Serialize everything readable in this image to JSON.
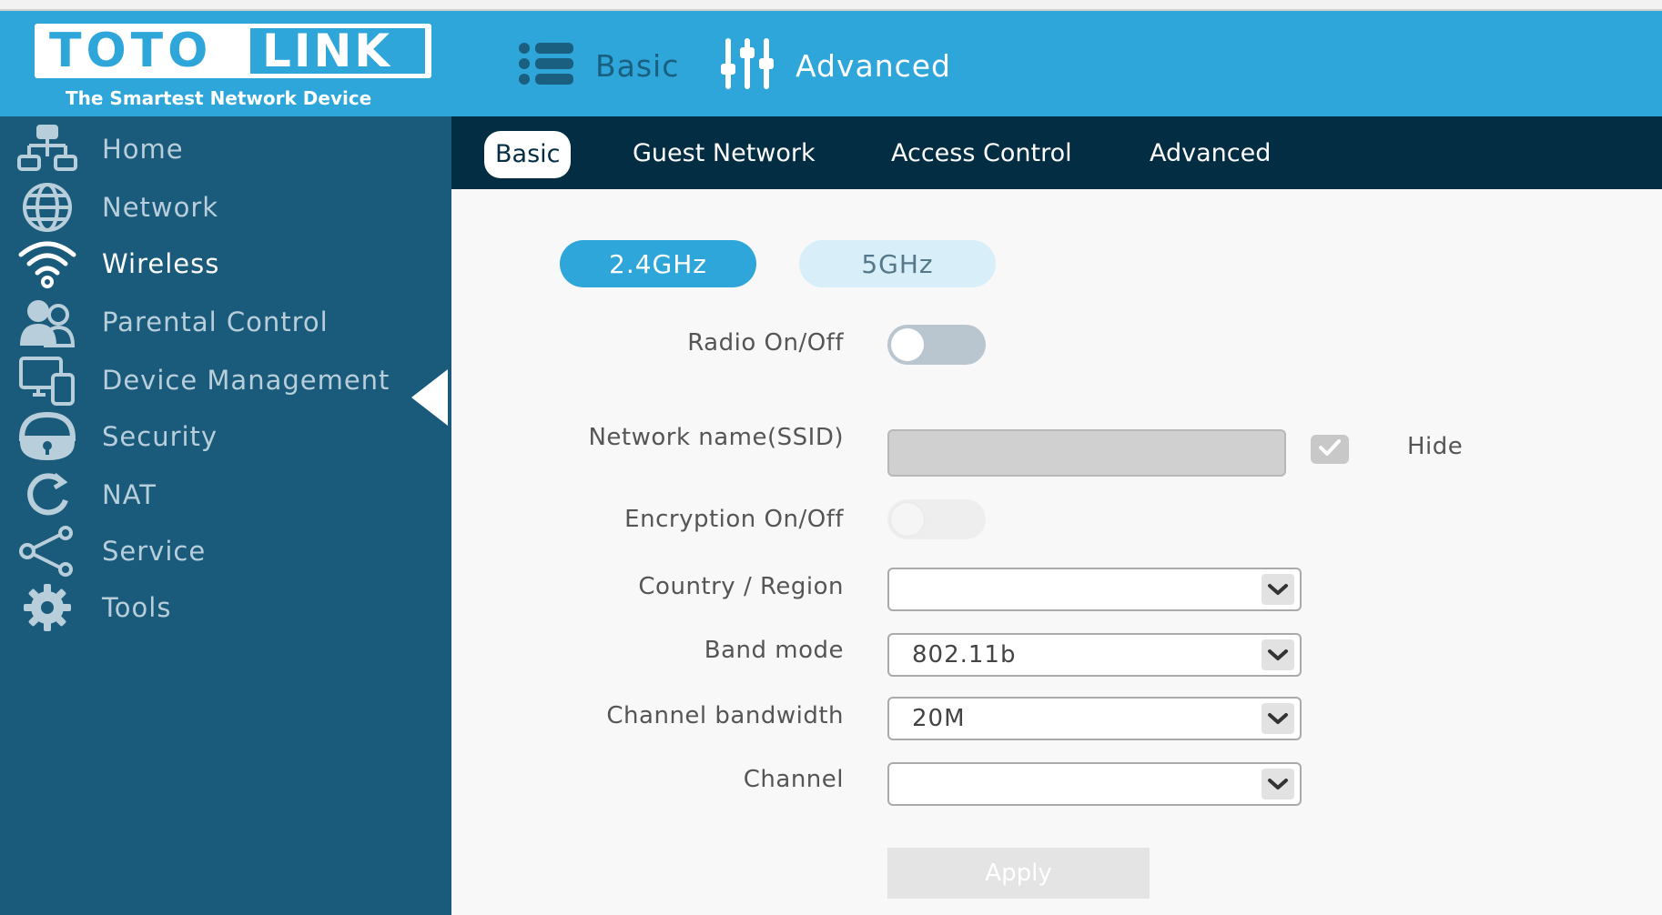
{
  "brand": {
    "logo_left": "TOTO",
    "logo_right": "LINK",
    "tagline": "The Smartest Network Device",
    "accent_color": "#2ea6da",
    "sidebar_color": "#1a5a7b",
    "subnav_color": "#032d42"
  },
  "header": {
    "modes": [
      {
        "label": "Basic",
        "icon": "list-icon",
        "active": false
      },
      {
        "label": "Advanced",
        "icon": "sliders-icon",
        "active": true
      }
    ]
  },
  "sidebar": {
    "items": [
      {
        "label": "Home",
        "icon": "home-network-icon"
      },
      {
        "label": "Network",
        "icon": "globe-icon"
      },
      {
        "label": "Wireless",
        "icon": "wifi-icon",
        "active": true
      },
      {
        "label": "Parental Control",
        "icon": "parental-users-icon"
      },
      {
        "label": "Device Management",
        "icon": "devices-icon"
      },
      {
        "label": "Security",
        "icon": "lock-icon"
      },
      {
        "label": "NAT",
        "icon": "refresh-icon"
      },
      {
        "label": "Service",
        "icon": "share-icon"
      },
      {
        "label": "Tools",
        "icon": "gear-icon"
      }
    ]
  },
  "subnav": {
    "tabs": [
      {
        "label": "Basic",
        "active": true
      },
      {
        "label": "Guest Network"
      },
      {
        "label": "Access Control"
      },
      {
        "label": "Advanced"
      }
    ]
  },
  "wireless": {
    "bands": [
      {
        "label": "2.4GHz",
        "active": true
      },
      {
        "label": "5GHz",
        "active": false
      }
    ],
    "radio": {
      "label": "Radio On/Off",
      "on": false
    },
    "ssid": {
      "label": "Network name(SSID)",
      "value": "",
      "hide_label": "Hide",
      "hide_checked": true
    },
    "encryption": {
      "label": "Encryption On/Off",
      "on": false
    },
    "country": {
      "label": "Country / Region",
      "value": ""
    },
    "band_mode": {
      "label": "Band mode",
      "value": "802.11b"
    },
    "channel_bandwidth": {
      "label": "Channel bandwidth",
      "value": "20M"
    },
    "channel": {
      "label": "Channel",
      "value": ""
    },
    "apply_label": "Apply"
  }
}
